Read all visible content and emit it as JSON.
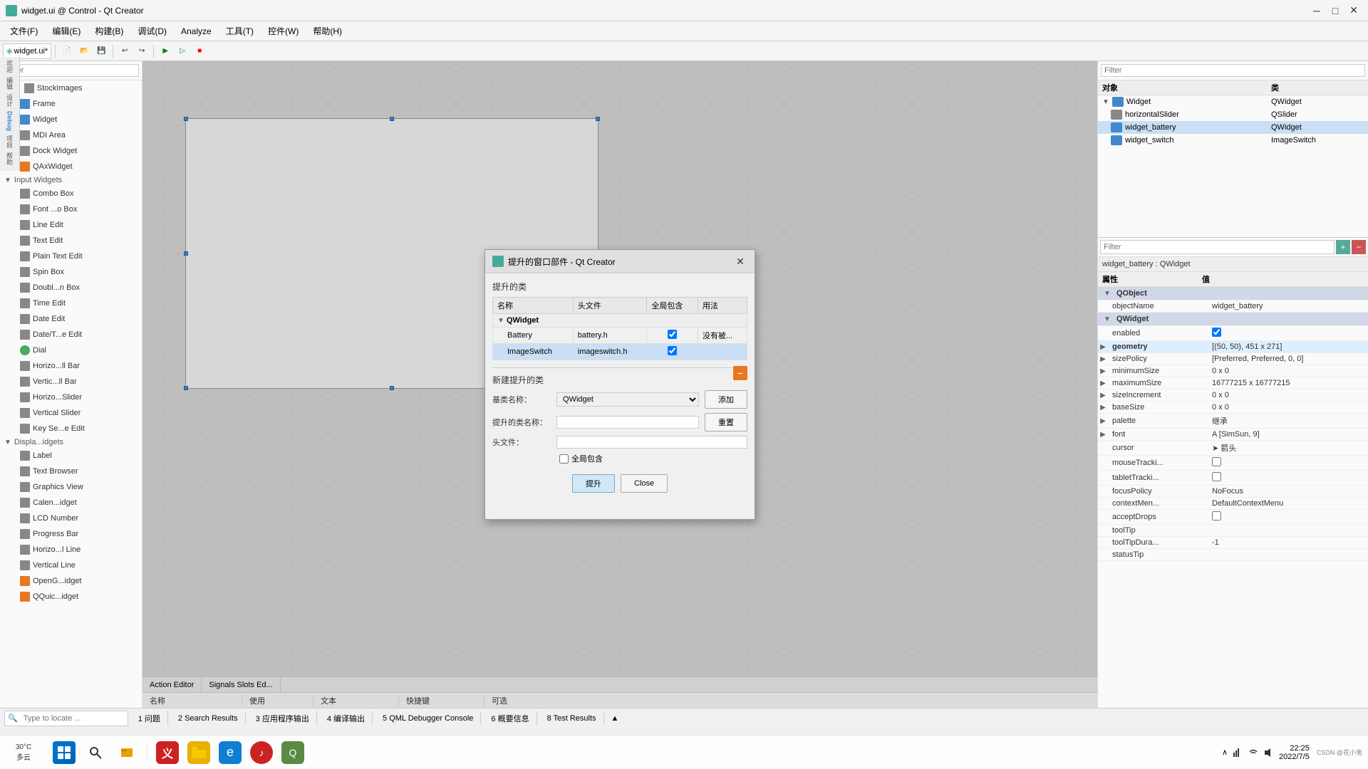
{
  "titleBar": {
    "title": "widget.ui @ Control - Qt Creator",
    "icon": "qt-creator-icon",
    "controls": [
      "minimize",
      "maximize",
      "close"
    ]
  },
  "menuBar": {
    "items": [
      {
        "label": "文件(F)"
      },
      {
        "label": "编辑(E)"
      },
      {
        "label": "构建(B)"
      },
      {
        "label": "调试(D)"
      },
      {
        "label": "Analyze"
      },
      {
        "label": "工具(T)"
      },
      {
        "label": "控件(W)"
      },
      {
        "label": "帮助(H)"
      }
    ]
  },
  "tabBar": {
    "tabs": [
      {
        "label": "widget.ui*"
      }
    ]
  },
  "leftSidebar": {
    "filterPlaceholder": "Filter",
    "items": [
      {
        "label": "StockImages",
        "level": 0,
        "type": "section"
      },
      {
        "label": "Frame",
        "level": 1
      },
      {
        "label": "Widget",
        "level": 1
      },
      {
        "label": "MDI Area",
        "level": 1
      },
      {
        "label": "Dock Widget",
        "level": 1
      },
      {
        "label": "QAxWidget",
        "level": 1
      },
      {
        "label": "Input Widgets",
        "level": 0,
        "type": "section"
      },
      {
        "label": "Combo Box",
        "level": 1
      },
      {
        "label": "Font ...o Box",
        "level": 1
      },
      {
        "label": "Line Edit",
        "level": 1
      },
      {
        "label": "Text Edit",
        "level": 1
      },
      {
        "label": "Plain Text Edit",
        "level": 1
      },
      {
        "label": "Spin Box",
        "level": 1
      },
      {
        "label": "Doubl...n Box",
        "level": 1
      },
      {
        "label": "Time Edit",
        "level": 1
      },
      {
        "label": "Date Edit",
        "level": 1
      },
      {
        "label": "Date/T...e Edit",
        "level": 1
      },
      {
        "label": "Dial",
        "level": 1
      },
      {
        "label": "Horizo...ll Bar",
        "level": 1
      },
      {
        "label": "Vertic...ll Bar",
        "level": 1
      },
      {
        "label": "Horizo...Slider",
        "level": 1
      },
      {
        "label": "Vertical Slider",
        "level": 1
      },
      {
        "label": "Key Se...e Edit",
        "level": 1
      },
      {
        "label": "Displa...idgets",
        "level": 0,
        "type": "section"
      },
      {
        "label": "Label",
        "level": 1
      },
      {
        "label": "Text Browser",
        "level": 1
      },
      {
        "label": "Graphics View",
        "level": 1
      },
      {
        "label": "Calen...idget",
        "level": 1
      },
      {
        "label": "LCD Number",
        "level": 1
      },
      {
        "label": "Progress Bar",
        "level": 1
      },
      {
        "label": "Horizo...l Line",
        "level": 1
      },
      {
        "label": "Vertical Line",
        "level": 1
      },
      {
        "label": "OpenG...idget",
        "level": 1
      },
      {
        "label": "QQuic...idget",
        "level": 1
      }
    ]
  },
  "canvas": {
    "columns": [
      "名称",
      "使用",
      "文本",
      "快捷键",
      "可选"
    ]
  },
  "bottomTabs": [
    "Action Editor",
    "Signals Slots Ed..."
  ],
  "statusBar": {
    "items": [
      "1 问题",
      "2 Search Results",
      "3 应用程序输出",
      "4 编译输出",
      "5 QML Debugger Console",
      "6 概要信息",
      "8 Test Results"
    ],
    "searchPlaceholder": "Type to locate ...",
    "upArrow": "▲"
  },
  "rightPanel": {
    "filterPlaceholder": "Filter",
    "filterBtns": [
      "+",
      "-"
    ],
    "objectHeader": [
      "对象",
      "类"
    ],
    "treeItems": [
      {
        "label": "Widget",
        "class": "QWidget",
        "level": 0
      },
      {
        "label": "horizontalSlider",
        "class": "QSlider",
        "level": 1
      },
      {
        "label": "widget_battery",
        "class": "QWidget",
        "level": 1
      },
      {
        "label": "widget_switch",
        "class": "ImageSwitch",
        "level": 1
      }
    ],
    "filter2Placeholder": "Filter",
    "selectedLabel": "widget_battery : QWidget",
    "propsHeader": [
      "属性",
      "值"
    ],
    "sections": [
      {
        "name": "QObject",
        "props": [
          {
            "key": "objectName",
            "val": "widget_battery"
          }
        ]
      },
      {
        "name": "QWidget",
        "props": [
          {
            "key": "enabled",
            "val": "☑",
            "type": "checkbox"
          },
          {
            "key": "geometry",
            "val": "[(50, 50), 451 x 271]",
            "expandable": true
          },
          {
            "key": "sizePolicy",
            "val": "[Preferred, Preferred, 0, 0]",
            "expandable": true
          },
          {
            "key": "minimumSize",
            "val": "0 x 0",
            "expandable": true
          },
          {
            "key": "maximumSize",
            "val": "16777215 x 16777215",
            "expandable": true
          },
          {
            "key": "sizeIncrement",
            "val": "0 x 0",
            "expandable": true
          },
          {
            "key": "baseSize",
            "val": "0 x 0",
            "expandable": true
          },
          {
            "key": "palette",
            "val": "继承",
            "expandable": true
          },
          {
            "key": "font",
            "val": "A [SimSun, 9]",
            "expandable": true
          },
          {
            "key": "cursor",
            "val": "➤ 箭头"
          },
          {
            "key": "mouseTracki...",
            "val": "□",
            "type": "checkbox"
          },
          {
            "key": "tabletTracki...",
            "val": "□",
            "type": "checkbox"
          },
          {
            "key": "focusPolicy",
            "val": "NoFocus"
          },
          {
            "key": "contextMen...",
            "val": "DefaultContextMenu"
          },
          {
            "key": "acceptDrops",
            "val": "□",
            "type": "checkbox"
          },
          {
            "key": "toolTip",
            "val": ""
          },
          {
            "key": "toolTipDura...",
            "val": "-1"
          },
          {
            "key": "statusTip",
            "val": ""
          }
        ]
      }
    ]
  },
  "dialog": {
    "title": "提升的窗口部件 - Qt Creator",
    "icon": "promote-icon",
    "sectionLabel": "提升的类",
    "tableHeaders": [
      "名称",
      "头文件",
      "全局包含",
      "用法"
    ],
    "treeRoot": "QWidget",
    "entries": [
      {
        "name": "Battery",
        "header": "battery.h",
        "globalInclude": true,
        "usage": "没有被..."
      },
      {
        "name": "ImageSwitch",
        "header": "imageswitch.h",
        "globalInclude": true,
        "usage": "",
        "selected": true
      }
    ],
    "newSectionLabel": "新建提升的类",
    "baseClassLabel": "基类名称：",
    "baseClassDefault": "QWidget",
    "promoteClassLabel": "提升的类名称：",
    "headerFileLabel": "头文件：",
    "globalIncludeLabel": "全局包含",
    "buttons": {
      "addLabel": "添加",
      "resetLabel": "重置",
      "promoteLabel": "提升",
      "closeLabel": "Close"
    }
  },
  "taskbar": {
    "clock": "22:25",
    "date": "2022/7/5",
    "weatherTemp": "30°C",
    "weatherDesc": "多云",
    "apps": [
      "windows",
      "search",
      "files",
      "redapp",
      "filemanager",
      "edge",
      "music",
      "qtcreator"
    ]
  }
}
